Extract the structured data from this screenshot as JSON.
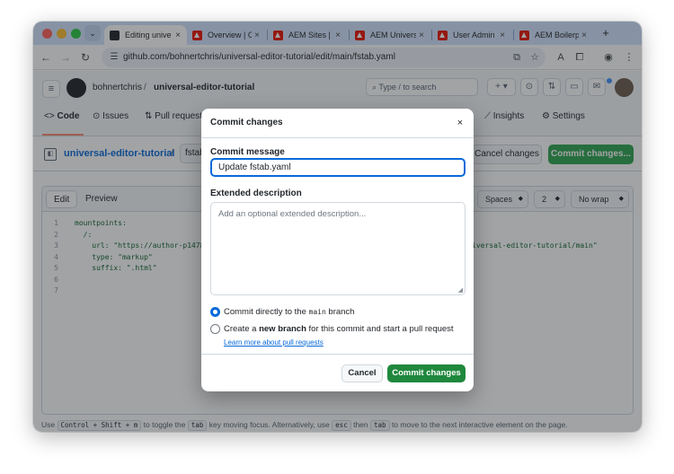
{
  "browser": {
    "tabs": [
      {
        "label": "Editing unive",
        "favicon": "github-icon",
        "active": true
      },
      {
        "label": "Overview | Cl",
        "favicon": "adobe-icon",
        "active": false
      },
      {
        "label": "AEM Sites | A",
        "favicon": "adobe-icon",
        "active": false
      },
      {
        "label": "AEM Univers",
        "favicon": "adobe-icon",
        "active": false
      },
      {
        "label": "User Admin",
        "favicon": "adobe-icon",
        "active": false
      },
      {
        "label": "AEM Boilerpl",
        "favicon": "adobe-icon",
        "active": false
      }
    ],
    "close_glyph": "×",
    "new_tab_glyph": "+",
    "url": "github.com/bohnertchris/universal-editor-tutorial/edit/main/fstab.yaml"
  },
  "github": {
    "owner": "bohnertchris",
    "separator": "/",
    "repo": "universal-editor-tutorial",
    "search_placeholder": "Type / to search",
    "nav": {
      "code": "Code",
      "issues": "Issues",
      "pull_requests": "Pull requests",
      "insights": "Insights",
      "settings": "Settings"
    },
    "breadcrumb_repo": "universal-editor-tutorial",
    "breadcrumb_file": "fstab",
    "cancel_changes": "Cancel changes",
    "commit_changes": "Commit changes...",
    "editor": {
      "tab_edit": "Edit",
      "tab_preview": "Preview",
      "indent_mode": "Spaces",
      "indent_size": "2",
      "wrap_mode": "No wrap",
      "lines": [
        {
          "n": "1",
          "text": "mountpoints:",
          "tail": ""
        },
        {
          "n": "2",
          "text": "  /:",
          "tail": ""
        },
        {
          "n": "3",
          "text": "    url: \"https://author-p14786",
          "tail": "iversal-editor-tutorial/main\""
        },
        {
          "n": "4",
          "text": "    type: \"markup\"",
          "tail": ""
        },
        {
          "n": "5",
          "text": "    suffix: \".html\"",
          "tail": ""
        },
        {
          "n": "6",
          "text": "",
          "tail": ""
        },
        {
          "n": "7",
          "text": "",
          "tail": ""
        }
      ]
    },
    "hint": {
      "use": "Use",
      "keys1": "Control + Shift + m",
      "mid1": "to toggle the",
      "key_tab": "tab",
      "mid2": "key moving focus. Alternatively, use",
      "key_esc": "esc",
      "mid3": "then",
      "mid4": "to move to the next interactive element on the page."
    }
  },
  "dialog": {
    "title": "Commit changes",
    "close_glyph": "×",
    "message_label": "Commit message",
    "message_value": "Update fstab.yaml",
    "description_label": "Extended description",
    "description_placeholder": "Add an optional extended description...",
    "option_direct_prefix": "Commit directly to the",
    "option_direct_branch": "main",
    "option_direct_suffix": "branch",
    "option_new_prefix": "Create a",
    "option_new_bold": "new branch",
    "option_new_suffix": "for this commit and start a pull request",
    "learn_more": "Learn more about pull requests",
    "cancel": "Cancel",
    "commit": "Commit changes"
  },
  "colors": {
    "accent_blue": "#0969da",
    "commit_green": "#1f883d",
    "tabstrip": "#d3e3fd"
  }
}
